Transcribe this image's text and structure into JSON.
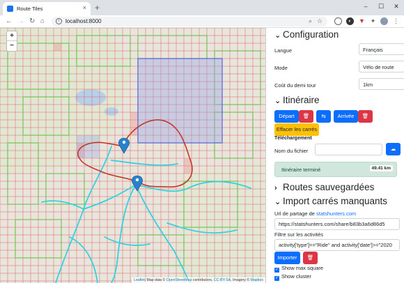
{
  "browser": {
    "tab_title": "Route Tiles",
    "tab_close": "×",
    "new_tab": "+",
    "url": "localhost:8000",
    "window_minimize": "–",
    "window_maximize": "☐",
    "window_close": "✕"
  },
  "map": {
    "zoom_in": "+",
    "zoom_out": "−",
    "attribution_leaflet": "Leaflet",
    "attribution_text": "| Map data © ",
    "attribution_osm": "OpenStreetMap",
    "attribution_contrib": " contributors, ",
    "attribution_ccbysa": "CC-BY-SA",
    "attribution_imagery": ", Imagery © ",
    "attribution_mapbox": "Mapbox"
  },
  "configuration": {
    "title": "Configuration",
    "langue_label": "Langue",
    "langue_value": "Français",
    "mode_label": "Mode",
    "mode_value": "Vélo de route",
    "demi_tour_label": "Coût du demi tour",
    "demi_tour_value": "1km"
  },
  "itineraire": {
    "title": "Itinéraire",
    "depart_label": "Départ",
    "arrivee_label": "Arrivée",
    "effacer_label": "Effacer les carrés",
    "telechargement_label": "Téléchargement",
    "nom_fichier_label": "Nom du fichier",
    "nom_fichier_value": "",
    "status_text": "Itinéraire terminé",
    "distance": "49.41 km"
  },
  "routes_sauvegardees": {
    "title": "Routes sauvegardées"
  },
  "import": {
    "title": "Import carrés manquants",
    "url_label_prefix": "Url de partage de ",
    "url_label_link": "statshunters.com",
    "url_value": "https://statshunters.com/share/b83b3a6d86d5",
    "filter_label": "Filtre sur les activités",
    "filter_value": "activity['type']==\"Ride\" and activity['date']>=\"2020",
    "importer_label": "Importer",
    "show_max_square": "Show max square",
    "show_cluster": "Show cluster"
  },
  "colors": {
    "primary": "#0d6efd",
    "danger": "#dc3545",
    "warning": "#ffc107",
    "route": "#c0392b",
    "river": "#36d1e0",
    "visited_tile": "#6cbf4a",
    "missing_tile": "#e04a4a",
    "max_square": "#5562d6"
  }
}
